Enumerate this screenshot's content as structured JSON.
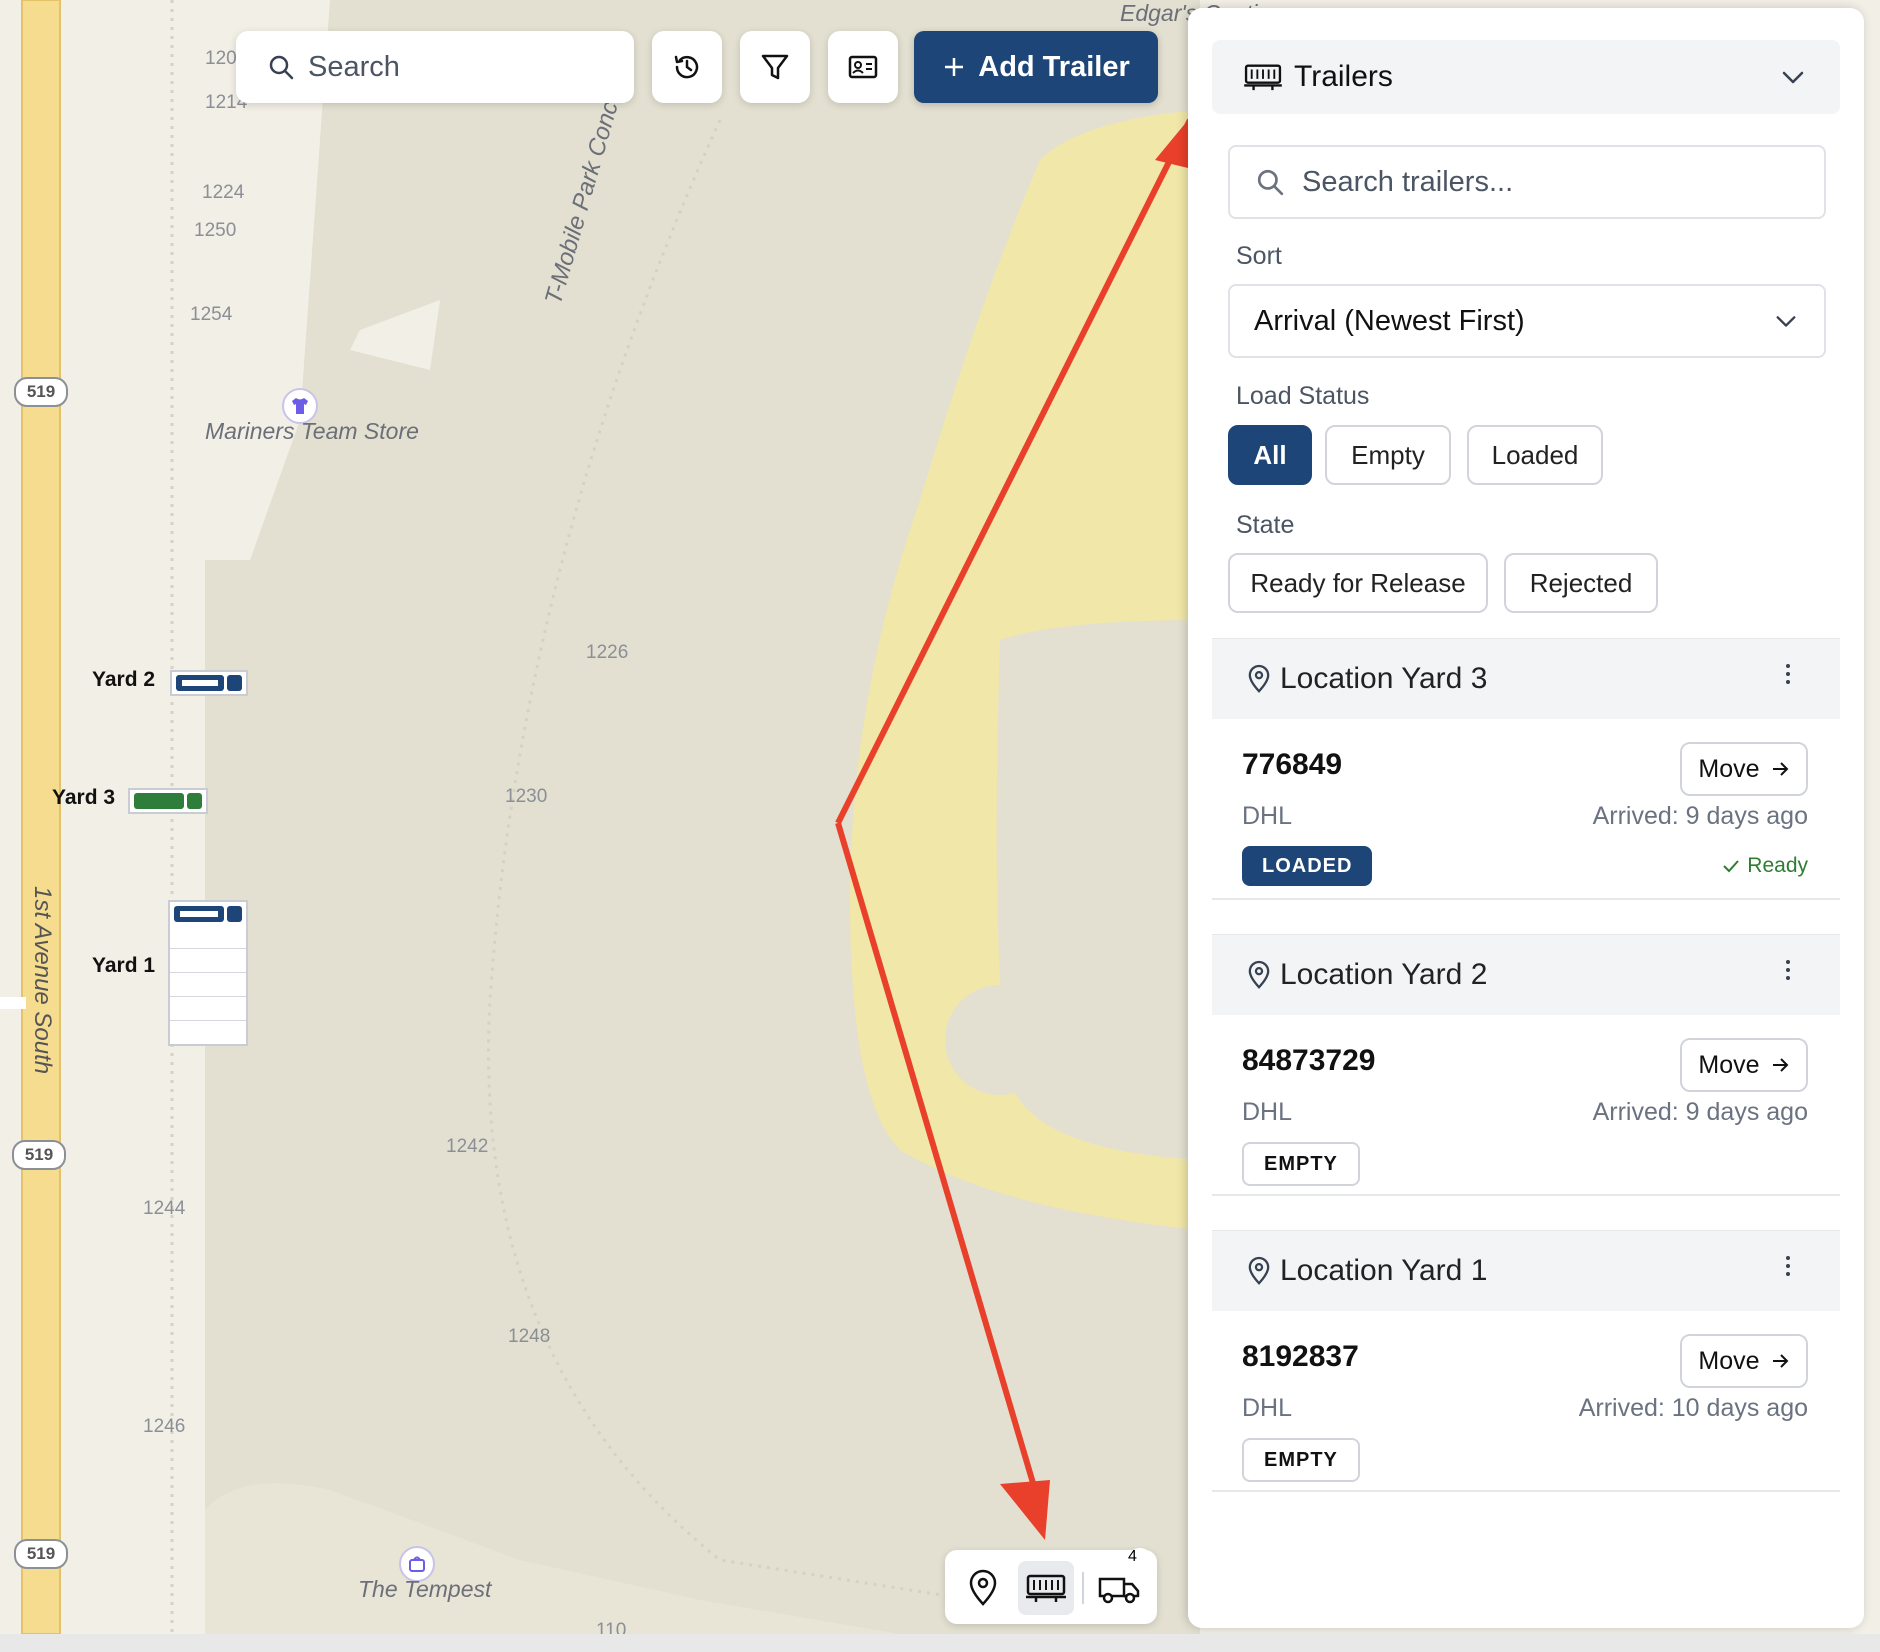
{
  "map": {
    "street_1st_ave": "1st Avenue South",
    "street_concourse": "T-Mobile Park Concourse",
    "route_shield": "519",
    "poi_store": "Mariners Team Store",
    "poi_tempest": "The Tempest",
    "poi_top": "Edgar's Cantina",
    "addresses": [
      "120",
      "1214",
      "1224",
      "1250",
      "1254",
      "1226",
      "1230",
      "1242",
      "1244",
      "1248",
      "1246",
      "110"
    ],
    "yards": [
      {
        "label": "Yard 2",
        "color": "#1d4577"
      },
      {
        "label": "Yard 3",
        "color": "#2f7d3a"
      },
      {
        "label": "Yard 1",
        "color": "#1d4577"
      }
    ]
  },
  "toolbar": {
    "search_placeholder": "Search",
    "history_icon": "history-icon",
    "filter_icon": "filter-icon",
    "id_card_icon": "id-card-icon",
    "add_trailer_label": "Add Trailer"
  },
  "dock": {
    "items": [
      "map-pin-icon",
      "trailer-icon",
      "truck-icon"
    ],
    "truck_badge": "4"
  },
  "panel": {
    "title": "Trailers",
    "search_placeholder": "Search trailers...",
    "sort_label": "Sort",
    "sort_value": "Arrival (Newest First)",
    "load_status_label": "Load Status",
    "load_status_options": [
      "All",
      "Empty",
      "Loaded"
    ],
    "load_status_selected": "All",
    "state_label": "State",
    "state_options": [
      "Ready for Release",
      "Rejected"
    ],
    "groups": [
      {
        "title": "Location Yard 3",
        "trailer": {
          "id": "776849",
          "carrier": "DHL",
          "arrived": "Arrived: 9 days ago",
          "status": "LOADED",
          "move_label": "Move",
          "ready": "Ready"
        }
      },
      {
        "title": "Location Yard 2",
        "trailer": {
          "id": "84873729",
          "carrier": "DHL",
          "arrived": "Arrived: 9 days ago",
          "status": "EMPTY",
          "move_label": "Move"
        }
      },
      {
        "title": "Location Yard 1",
        "trailer": {
          "id": "8192837",
          "carrier": "DHL",
          "arrived": "Arrived: 10 days ago",
          "status": "EMPTY",
          "move_label": "Move"
        }
      }
    ]
  },
  "colors": {
    "primary": "#1d4577",
    "ready_green": "#2e7d32",
    "annotation_arrow": "#e8402a",
    "badge_red": "#d0342c"
  }
}
